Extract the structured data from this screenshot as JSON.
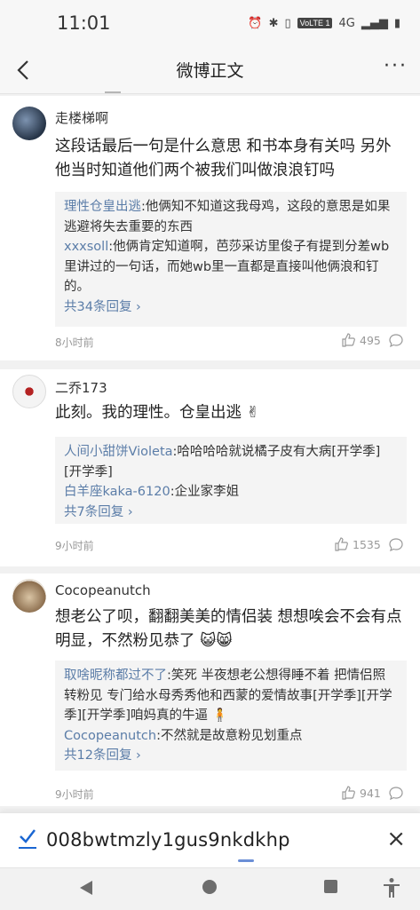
{
  "status_bar": {
    "time": "11:01",
    "network": "4G",
    "volte": "VoLTE 1"
  },
  "header": {
    "title": "微博正文",
    "more": "···"
  },
  "comments": [
    {
      "username": "走楼梯啊",
      "content": "这段话最后一句是什么意思 和书本身有关吗 另外 他当时知道他们两个被我们叫做浪浪钉吗",
      "replies": [
        {
          "user": "理性仓皇出逃",
          "text": ":他俩知不知道这我母鸡，这段的意思是如果逃避将失去重要的东西"
        },
        {
          "user": "xxxsoll",
          "text": ":他俩肯定知道啊，芭莎采访里俊子有提到分差wb里讲过的一句话，而她wb里一直都是直接叫他俩浪和钉的。"
        }
      ],
      "more_replies": "共34条回复",
      "time": "8小时前",
      "likes": "495"
    },
    {
      "username": "二乔173",
      "content": "此刻。我的理性。仓皇出逃",
      "replies": [
        {
          "user": "人间小甜饼Violeta",
          "text": ":哈哈哈哈就说橘子皮有大病[开学季][开学季]"
        },
        {
          "user": "白羊座kaka-6120",
          "text": ":企业家李姐"
        }
      ],
      "more_replies": "共7条回复",
      "time": "9小时前",
      "likes": "1535"
    },
    {
      "username": "Cocopeanutch",
      "content": "想老公了呗，翻翻美美的情侣装 想想唉会不会有点明显，不然粉见恭了",
      "replies": [
        {
          "user": "取啥昵称都过不了",
          "text": ":笑死 半夜想老公想得睡不着 把情侣照转粉见 专门给水母秀秀他和西蒙的爱情故事[开学季][开学季][开学季]咱妈真的牛逼"
        },
        {
          "user": "Cocopeanutch",
          "text": ":不然就是故意粉见划重点"
        }
      ],
      "more_replies": "共12条回复",
      "time": "9小时前",
      "likes": "941"
    }
  ],
  "input_bar": {
    "value": "008bwtmzly1gus9nkdkhp",
    "close": "×"
  },
  "icons": {
    "back": "chevron-left-icon",
    "like": "thumbs-up-icon",
    "comment": "comment-bubble-icon",
    "check": "check-icon",
    "accessibility": "accessibility-icon"
  },
  "colors": {
    "link": "#5b7da8",
    "accent": "#1a66d2"
  }
}
